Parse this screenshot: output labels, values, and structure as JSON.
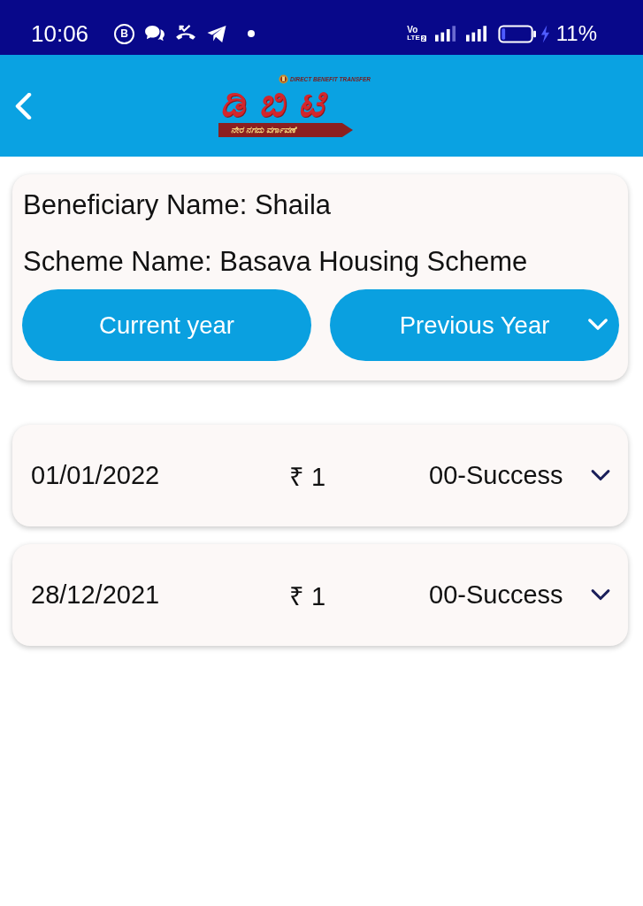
{
  "status_bar": {
    "time": "10:06",
    "notifications": [
      {
        "kind": "letter",
        "text": "B"
      },
      {
        "kind": "chat"
      },
      {
        "kind": "missed-call"
      },
      {
        "kind": "send"
      },
      {
        "kind": "dot"
      }
    ],
    "network": {
      "top": "Vo",
      "bottom": "LTE",
      "sim": "2"
    },
    "charging": true,
    "battery": "11%"
  },
  "header": {
    "logo": {
      "tagline": "DIRECT BENEFIT TRANSFER",
      "wordmark": "ಡಿಬಿಟಿ",
      "subtitle": "ನೇರ ನಗದು ವರ್ಗಾವಣೆ"
    }
  },
  "beneficiary": {
    "details": [
      "Beneficiary Name: Shaila",
      "Scheme Name: Basava Housing Scheme"
    ],
    "buttons": [
      {
        "label": "Current year",
        "kind": "button"
      },
      {
        "label": "Previous Year",
        "kind": "dropdown"
      }
    ]
  },
  "payments": [
    {
      "date": "01/01/2022",
      "amount": "₹ 1",
      "status": "00-Success",
      "expanded": false
    },
    {
      "date": "28/12/2021",
      "amount": "₹ 1",
      "status": "00-Success",
      "expanded": false
    }
  ]
}
